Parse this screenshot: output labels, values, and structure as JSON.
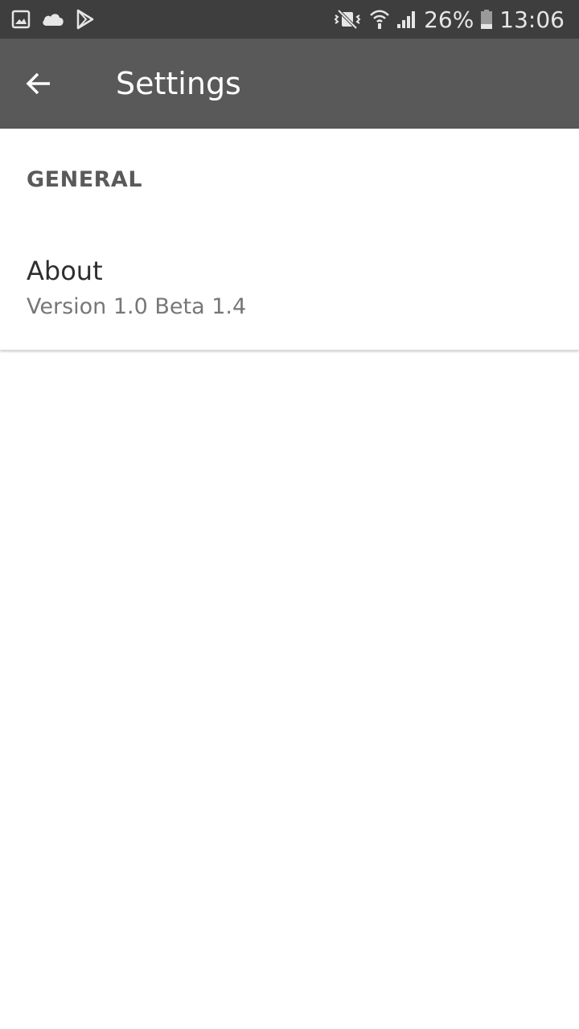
{
  "status_bar": {
    "left_icons": [
      "gallery-icon",
      "cloud-icon",
      "play-store-icon"
    ],
    "right_icons": [
      "vibrate-off-icon",
      "wifi-icon",
      "signal-icon",
      "battery-icon"
    ],
    "battery": "26%",
    "time": "13:06"
  },
  "app_bar": {
    "back_icon": "back-arrow-icon",
    "title": "Settings"
  },
  "settings": {
    "section_general": "GENERAL",
    "items": [
      {
        "title": "About",
        "summary": "Version 1.0 Beta 1.4"
      }
    ]
  },
  "colors": {
    "status_bar_bg": "#3e3e3e",
    "app_bar_bg": "#595959",
    "section_header": "#5a5a5a",
    "title_text": "#2e2e2e",
    "summary_text": "#777777"
  }
}
